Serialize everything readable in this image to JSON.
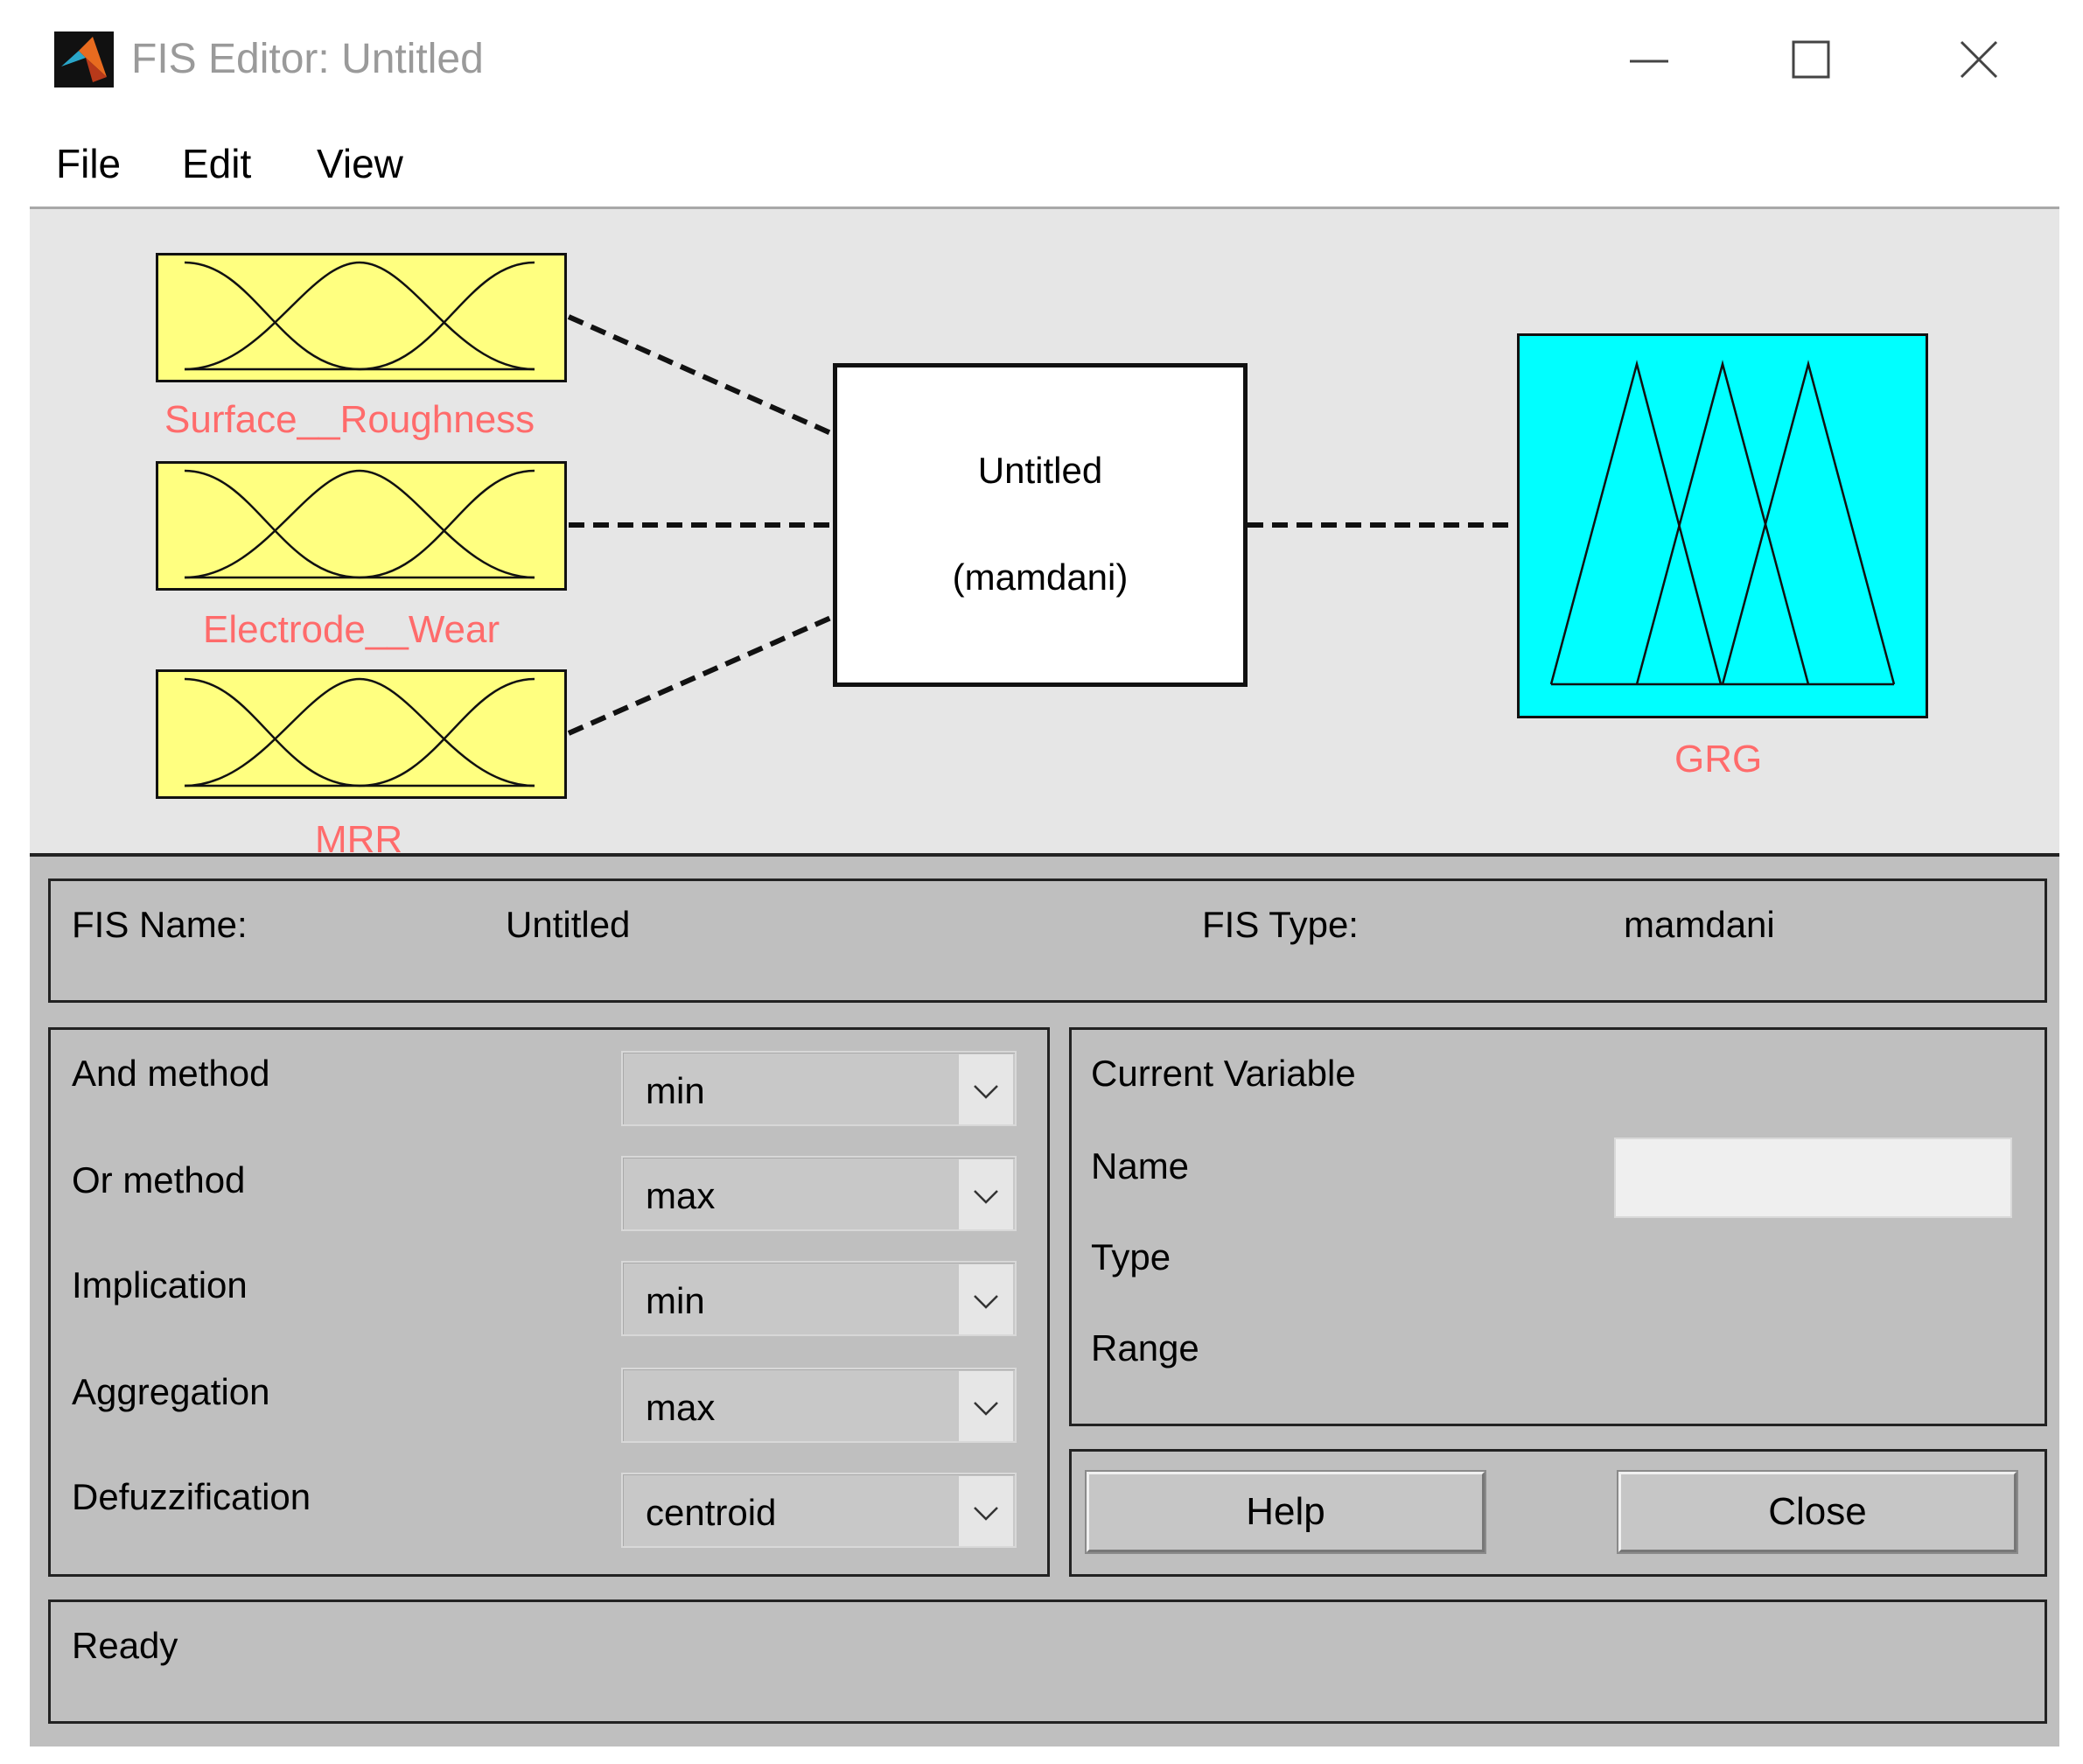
{
  "window": {
    "title": "FIS Editor: Untitled",
    "icon": "matlab-logo-icon",
    "controls": [
      "minimize-icon",
      "maximize-icon",
      "close-icon"
    ]
  },
  "menu": {
    "file": "File",
    "edit": "Edit",
    "view": "View"
  },
  "diagram": {
    "inputs": [
      {
        "name": "Surface__Roughness"
      },
      {
        "name": "Electrode__Wear"
      },
      {
        "name": "MRR"
      }
    ],
    "system": {
      "name": "Untitled",
      "type": "(mamdani)"
    },
    "output": {
      "name": "GRG"
    },
    "colors": {
      "input_fill": "#ffff80",
      "output_fill": "#00ffff",
      "label": "#ff6b6b"
    }
  },
  "info": {
    "fis_name_label": "FIS Name:",
    "fis_name_value": "Untitled",
    "fis_type_label": "FIS Type:",
    "fis_type_value": "mamdani"
  },
  "methods": [
    {
      "label": "And method",
      "value": "min"
    },
    {
      "label": "Or method",
      "value": "max"
    },
    {
      "label": "Implication",
      "value": "min"
    },
    {
      "label": "Aggregation",
      "value": "max"
    },
    {
      "label": "Defuzzification",
      "value": "centroid"
    }
  ],
  "current_variable": {
    "heading": "Current Variable",
    "name_label": "Name",
    "type_label": "Type",
    "range_label": "Range",
    "name_value": ""
  },
  "buttons": {
    "help": "Help",
    "close": "Close"
  },
  "status": "Ready"
}
